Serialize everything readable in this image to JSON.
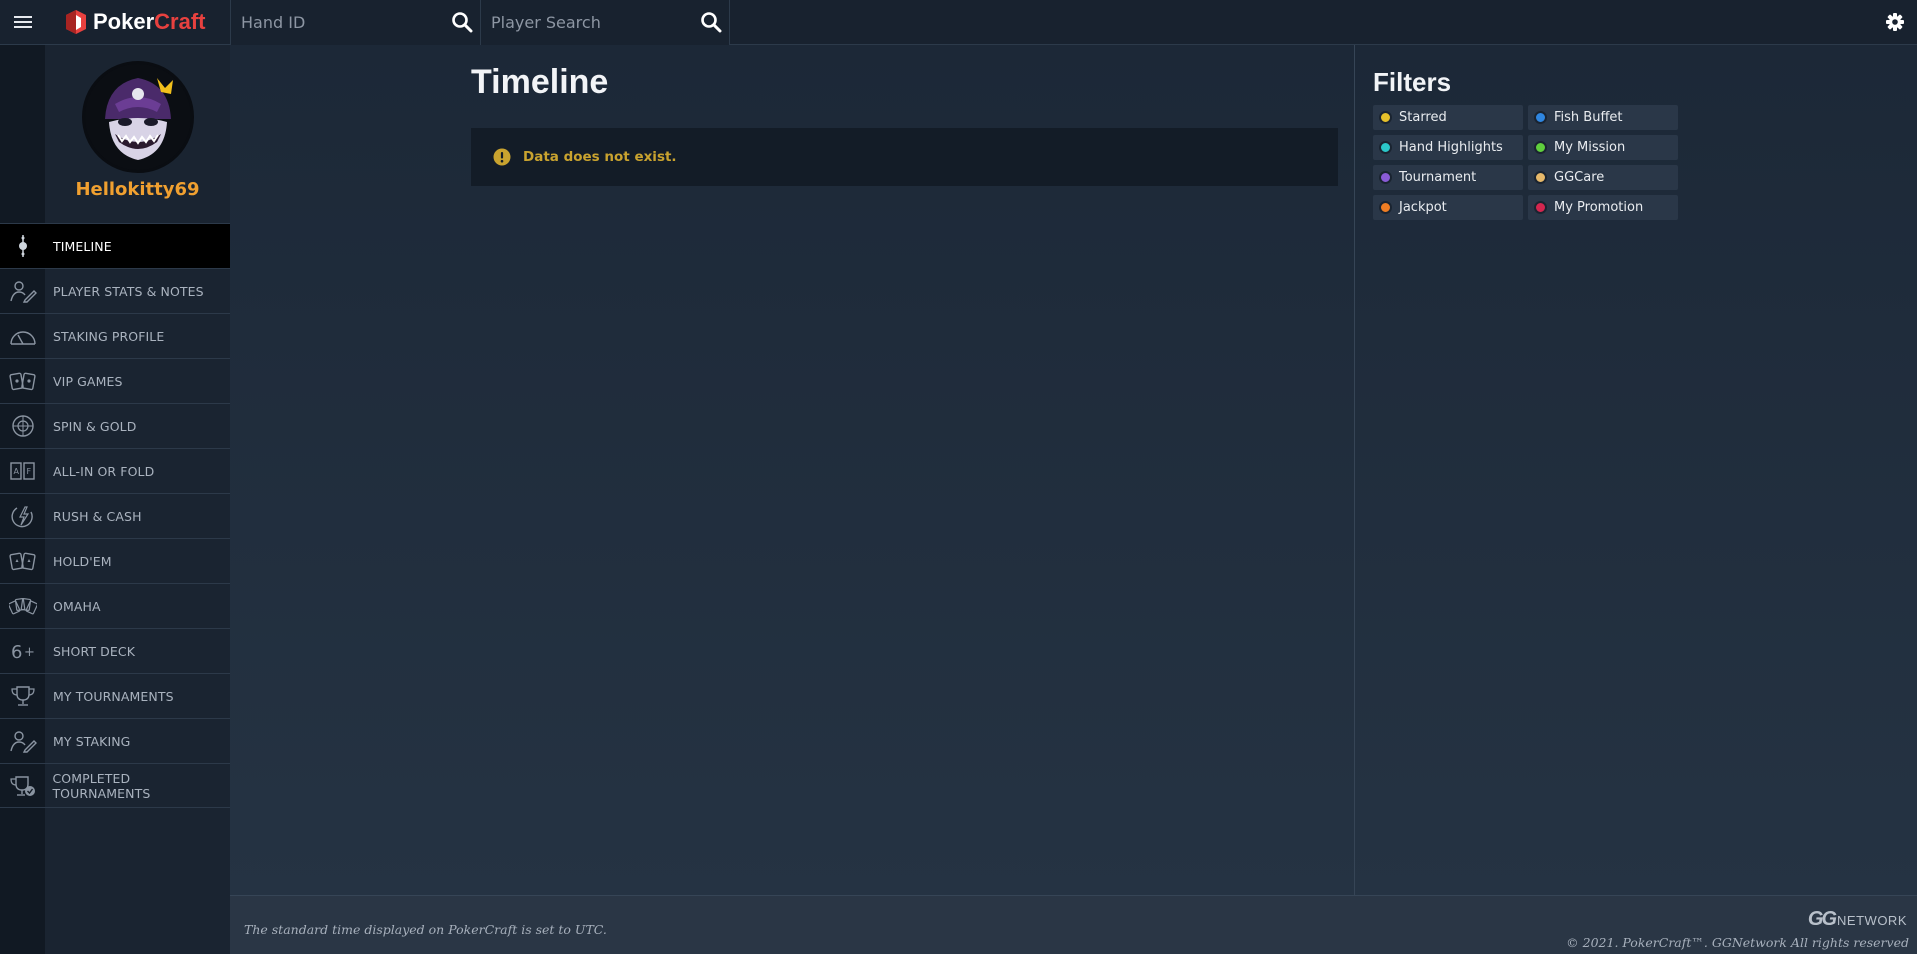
{
  "header": {
    "logo_part1": "Poker",
    "logo_part2": "Craft",
    "hand_id_placeholder": "Hand ID",
    "player_search_placeholder": "Player Search"
  },
  "profile": {
    "username": "Hellokitty69"
  },
  "sidebar": {
    "items": [
      {
        "label": "TIMELINE",
        "icon": "timeline-icon",
        "active": true
      },
      {
        "label": "PLAYER STATS & NOTES",
        "icon": "player-stats-icon"
      },
      {
        "label": "STAKING PROFILE",
        "icon": "gauge-icon"
      },
      {
        "label": "VIP GAMES",
        "icon": "cards-icon"
      },
      {
        "label": "SPIN & GOLD",
        "icon": "spin-icon"
      },
      {
        "label": "ALL-IN OR FOLD",
        "icon": "all-in-icon"
      },
      {
        "label": "RUSH & CASH",
        "icon": "rush-icon"
      },
      {
        "label": "HOLD'EM",
        "icon": "holdem-icon"
      },
      {
        "label": "OMAHA",
        "icon": "omaha-icon"
      },
      {
        "label": "SHORT DECK",
        "icon": "six-plus-icon"
      },
      {
        "label": "MY TOURNAMENTS",
        "icon": "trophy-icon"
      },
      {
        "label": "MY STAKING",
        "icon": "staking-icon"
      },
      {
        "label": "COMPLETED TOURNAMENTS",
        "icon": "trophy-check-icon"
      }
    ]
  },
  "main": {
    "title": "Timeline",
    "alert": "Data does not exist."
  },
  "filters": {
    "title": "Filters",
    "items": [
      {
        "label": "Starred",
        "color": "#e6c02a"
      },
      {
        "label": "Fish Buffet",
        "color": "#2f86e0"
      },
      {
        "label": "Hand Highlights",
        "color": "#2bc7c9"
      },
      {
        "label": "My Mission",
        "color": "#5fcf3d"
      },
      {
        "label": "Tournament",
        "color": "#8a5bd6"
      },
      {
        "label": "GGCare",
        "color": "#e6b86a"
      },
      {
        "label": "Jackpot",
        "color": "#ef7d23"
      },
      {
        "label": "My Promotion",
        "color": "#d3264f"
      }
    ]
  },
  "footer": {
    "utc_note": "The standard time displayed on PokerCraft is set to UTC.",
    "network_logo_gg": "GG",
    "network_logo_text": "NETWORK",
    "copyright": "© 2021. PokerCraft™. GGNetwork All rights reserved"
  }
}
